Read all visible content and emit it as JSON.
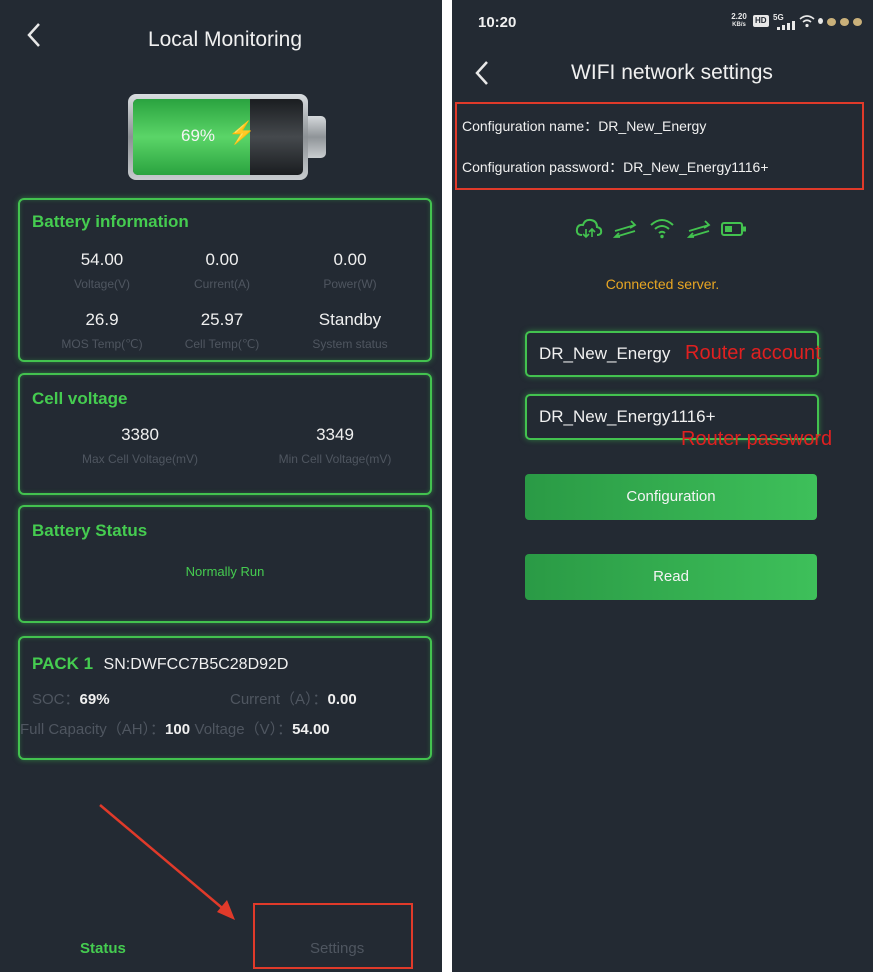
{
  "left": {
    "back_icon": "chevron-left-icon",
    "title": "Local Monitoring",
    "battery_percent": "69%",
    "battery_level": 0.69,
    "battery_information": {
      "title": "Battery information",
      "items": [
        {
          "value": "54.00",
          "label": "Voltage(V)"
        },
        {
          "value": "0.00",
          "label": "Current(A)"
        },
        {
          "value": "0.00",
          "label": "Power(W)"
        },
        {
          "value": "26.9",
          "label": "MOS Temp(℃)"
        },
        {
          "value": "25.97",
          "label": "Cell Temp(℃)"
        },
        {
          "value": "Standby",
          "label": "System status"
        }
      ]
    },
    "cell_voltage": {
      "title": "Cell voltage",
      "items": [
        {
          "value": "3380",
          "label": "Max Cell Voltage(mV)"
        },
        {
          "value": "3349",
          "label": "Min Cell Voltage(mV)"
        }
      ]
    },
    "battery_status": {
      "title": "Battery Status",
      "status": "Normally Run"
    },
    "pack": {
      "name": "PACK 1",
      "sn": "SN:DWFCC7B5C28D92D",
      "soc_label": "SOC：",
      "soc_value": "69%",
      "current_label": "Current（A）：",
      "current_value": "0.00",
      "capacity_label": "Full Capacity（AH）：",
      "capacity_value": "100",
      "voltage_label": "Voltage（V）：",
      "voltage_value": "54.00"
    },
    "tabs": [
      {
        "label": "Status"
      },
      {
        "label": "Settings"
      }
    ]
  },
  "right": {
    "time": "10:20",
    "net_speed_value": "2.20",
    "net_speed_unit": "KB/s",
    "hd_badge": "HD",
    "signal_badge": "5G",
    "back_icon": "chevron-left-icon",
    "title": "WIFI network settings",
    "config_name_label": "Configuration name：",
    "config_name_value": "DR_New_Energy",
    "config_password_label": "Configuration password：",
    "config_password_value": "DR_New_Energy1116+",
    "connection_status": "Connected server.",
    "router_account_value": "DR_New_Energy",
    "router_account_annotation": "Router account",
    "router_password_value": "DR_New_Energy1116+",
    "router_password_annotation": "Router password",
    "configuration_button": "Configuration",
    "read_button": "Read"
  },
  "colors": {
    "background": "#232a33",
    "accent_green": "#43c24f",
    "muted_label": "#4f5660",
    "status_orange": "#e8a623",
    "annotation_red": "#e02020"
  }
}
